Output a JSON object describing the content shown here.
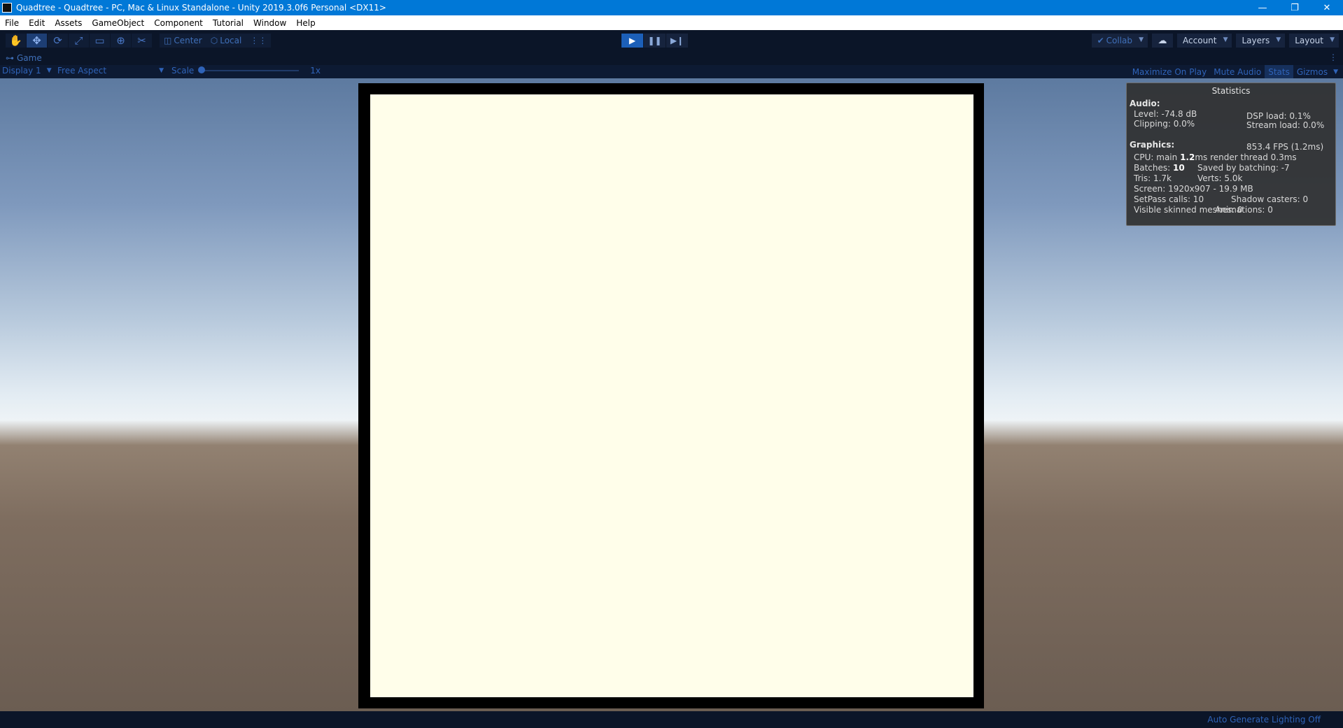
{
  "window": {
    "title": "Quadtree - Quadtree - PC, Mac & Linux Standalone - Unity 2019.3.0f6 Personal <DX11>",
    "controls": {
      "minimize": "—",
      "restore": "❐",
      "close": "✕"
    }
  },
  "menu": [
    "File",
    "Edit",
    "Assets",
    "GameObject",
    "Component",
    "Tutorial",
    "Window",
    "Help"
  ],
  "toolbar": {
    "tools": [
      {
        "name": "hand-tool-icon",
        "glyph": "✋"
      },
      {
        "name": "move-tool-icon",
        "glyph": "✥",
        "active": true
      },
      {
        "name": "rotate-tool-icon",
        "glyph": "⟳"
      },
      {
        "name": "scale-tool-icon",
        "glyph": "⤢"
      },
      {
        "name": "rect-tool-icon",
        "glyph": "▭"
      },
      {
        "name": "transform-tool-icon",
        "glyph": "⊕"
      },
      {
        "name": "custom-tool-icon",
        "glyph": "✂"
      }
    ],
    "pivot_mode": "Center",
    "pivot_rotation": "Local",
    "grid_icon": "grid-snap-icon",
    "play": {
      "play": "▶",
      "pause": "❚❚",
      "step": "▶❙"
    },
    "collab": "Collab",
    "account": "Account",
    "layers": "Layers",
    "layout": "Layout"
  },
  "game_view": {
    "tab_label": "Game",
    "display": "Display 1",
    "aspect": "Free Aspect",
    "scale_label": "Scale",
    "scale_value": "1x",
    "scale_level": 0.0,
    "maximize_on_play": "Maximize On Play",
    "mute_audio": "Mute Audio",
    "stats": "Stats",
    "gizmos": "Gizmos"
  },
  "stats_panel": {
    "title": "Statistics",
    "audio_label": "Audio:",
    "level": "Level: -74.8 dB",
    "dsp_load": "DSP load: 0.1%",
    "clipping": "Clipping: 0.0%",
    "stream_load": "Stream load: 0.0%",
    "graphics_label": "Graphics:",
    "fps": "853.4 FPS (1.2ms)",
    "cpu_main_prefix": "CPU: main ",
    "cpu_main_value": "1.2",
    "cpu_main_suffix": "ms  render thread 0.3ms",
    "batches_prefix": "Batches: ",
    "batches_value": "10",
    "saved_by_batching": "Saved by batching: -7",
    "tris": "Tris: 1.7k",
    "verts": "Verts: 5.0k",
    "screen": "Screen: 1920x907 - 19.9 MB",
    "setpass": "SetPass calls: 10",
    "shadow_casters": "Shadow casters: 0",
    "skinned": "Visible skinned meshes: 0",
    "animations": "Animations: 0"
  },
  "status_bar": {
    "lighting": "Auto Generate Lighting Off"
  },
  "colors": {
    "titlebar": "#0078d7",
    "toolbar": "#0b1528",
    "accent": "#2f63b8",
    "board": "#fffeea",
    "board_frame": "#000000"
  }
}
